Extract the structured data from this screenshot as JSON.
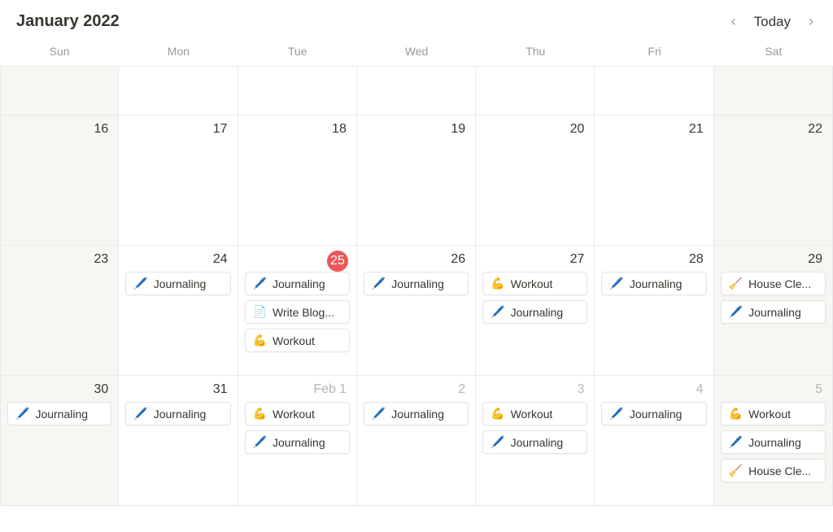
{
  "header": {
    "title": "January 2022",
    "today_label": "Today"
  },
  "weekdays": [
    "Sun",
    "Mon",
    "Tue",
    "Wed",
    "Thu",
    "Fri",
    "Sat"
  ],
  "icons": {
    "journaling": "🖊️",
    "workout": "💪",
    "blog": "📄",
    "clean": "🧹"
  },
  "rows": [
    {
      "height": "short",
      "days": [
        {
          "num": "",
          "weekend": true,
          "events": []
        },
        {
          "num": "",
          "events": []
        },
        {
          "num": "",
          "events": []
        },
        {
          "num": "",
          "events": []
        },
        {
          "num": "",
          "events": []
        },
        {
          "num": "",
          "events": []
        },
        {
          "num": "",
          "weekend": true,
          "events": []
        }
      ]
    },
    {
      "height": "tall",
      "days": [
        {
          "num": "16",
          "weekend": true,
          "events": []
        },
        {
          "num": "17",
          "events": []
        },
        {
          "num": "18",
          "events": []
        },
        {
          "num": "19",
          "events": []
        },
        {
          "num": "20",
          "events": []
        },
        {
          "num": "21",
          "events": []
        },
        {
          "num": "22",
          "weekend": true,
          "events": []
        }
      ]
    },
    {
      "height": "tall",
      "days": [
        {
          "num": "23",
          "weekend": true,
          "events": []
        },
        {
          "num": "24",
          "events": [
            {
              "icon": "journaling",
              "label": "Journaling",
              "name": "event-journaling"
            }
          ]
        },
        {
          "num": "25",
          "today": true,
          "events": [
            {
              "icon": "journaling",
              "label": "Journaling",
              "name": "event-journaling"
            },
            {
              "icon": "blog",
              "label": "Write Blog...",
              "name": "event-write-blog"
            },
            {
              "icon": "workout",
              "label": "Workout",
              "name": "event-workout"
            }
          ]
        },
        {
          "num": "26",
          "events": [
            {
              "icon": "journaling",
              "label": "Journaling",
              "name": "event-journaling"
            }
          ]
        },
        {
          "num": "27",
          "events": [
            {
              "icon": "workout",
              "label": "Workout",
              "name": "event-workout"
            },
            {
              "icon": "journaling",
              "label": "Journaling",
              "name": "event-journaling"
            }
          ]
        },
        {
          "num": "28",
          "events": [
            {
              "icon": "journaling",
              "label": "Journaling",
              "name": "event-journaling"
            }
          ]
        },
        {
          "num": "29",
          "weekend": true,
          "events": [
            {
              "icon": "clean",
              "label": "House Cle...",
              "name": "event-house-cleaning"
            },
            {
              "icon": "journaling",
              "label": "Journaling",
              "name": "event-journaling"
            }
          ]
        }
      ]
    },
    {
      "height": "tall",
      "days": [
        {
          "num": "30",
          "weekend": true,
          "events": [
            {
              "icon": "journaling",
              "label": "Journaling",
              "name": "event-journaling"
            }
          ]
        },
        {
          "num": "31",
          "events": [
            {
              "icon": "journaling",
              "label": "Journaling",
              "name": "event-journaling"
            }
          ]
        },
        {
          "num": "1",
          "month_prefix": "Feb",
          "other_month": true,
          "events": [
            {
              "icon": "workout",
              "label": "Workout",
              "name": "event-workout"
            },
            {
              "icon": "journaling",
              "label": "Journaling",
              "name": "event-journaling"
            }
          ]
        },
        {
          "num": "2",
          "other_month": true,
          "events": [
            {
              "icon": "journaling",
              "label": "Journaling",
              "name": "event-journaling"
            }
          ]
        },
        {
          "num": "3",
          "other_month": true,
          "events": [
            {
              "icon": "workout",
              "label": "Workout",
              "name": "event-workout"
            },
            {
              "icon": "journaling",
              "label": "Journaling",
              "name": "event-journaling"
            }
          ]
        },
        {
          "num": "4",
          "other_month": true,
          "events": [
            {
              "icon": "journaling",
              "label": "Journaling",
              "name": "event-journaling"
            }
          ]
        },
        {
          "num": "5",
          "weekend": true,
          "other_month": true,
          "events": [
            {
              "icon": "workout",
              "label": "Workout",
              "name": "event-workout"
            },
            {
              "icon": "journaling",
              "label": "Journaling",
              "name": "event-journaling"
            },
            {
              "icon": "clean",
              "label": "House Cle...",
              "name": "event-house-cleaning"
            }
          ]
        }
      ]
    }
  ]
}
